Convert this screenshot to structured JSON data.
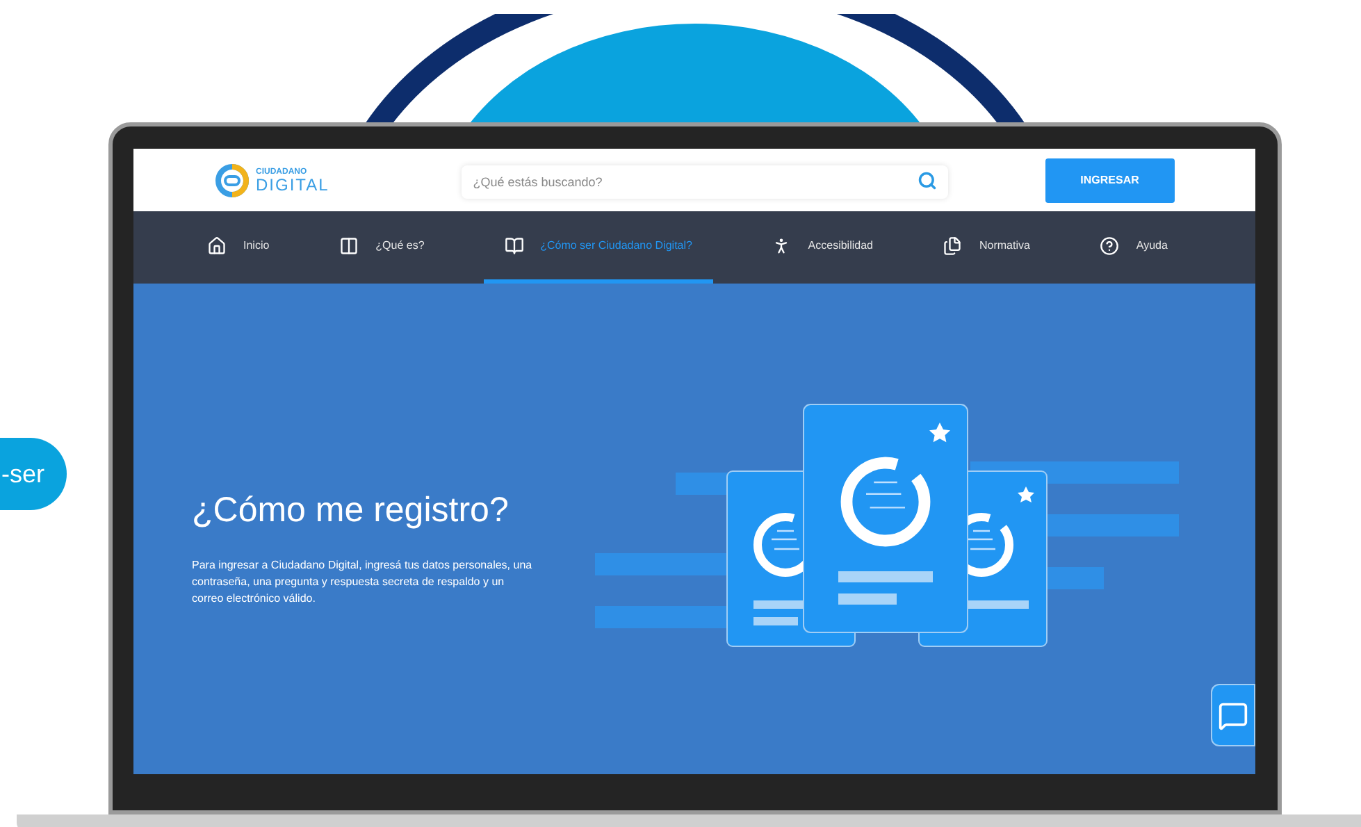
{
  "side_button": {
    "label": "-ser"
  },
  "header": {
    "logo": {
      "line1": "CIUDADANO",
      "line2": "DIGITAL"
    },
    "search": {
      "placeholder": "¿Qué estás buscando?"
    },
    "login_button": "INGRESAR"
  },
  "nav": [
    {
      "label": "Inicio",
      "selected": false
    },
    {
      "label": "¿Qué es?",
      "selected": false
    },
    {
      "label": "¿Cómo ser Ciudadano Digital?",
      "selected": true
    },
    {
      "label": "Accesibilidad",
      "selected": false
    },
    {
      "label": "Normativa",
      "selected": false
    },
    {
      "label": "Ayuda",
      "selected": false
    }
  ],
  "hero": {
    "title": "¿Cómo me registro?",
    "body": "Para ingresar a Ciudadano Digital, ingresá tus datos personales, una contraseña, una pregunta y respuesta secreta de respaldo y un correo electrónico válido."
  }
}
